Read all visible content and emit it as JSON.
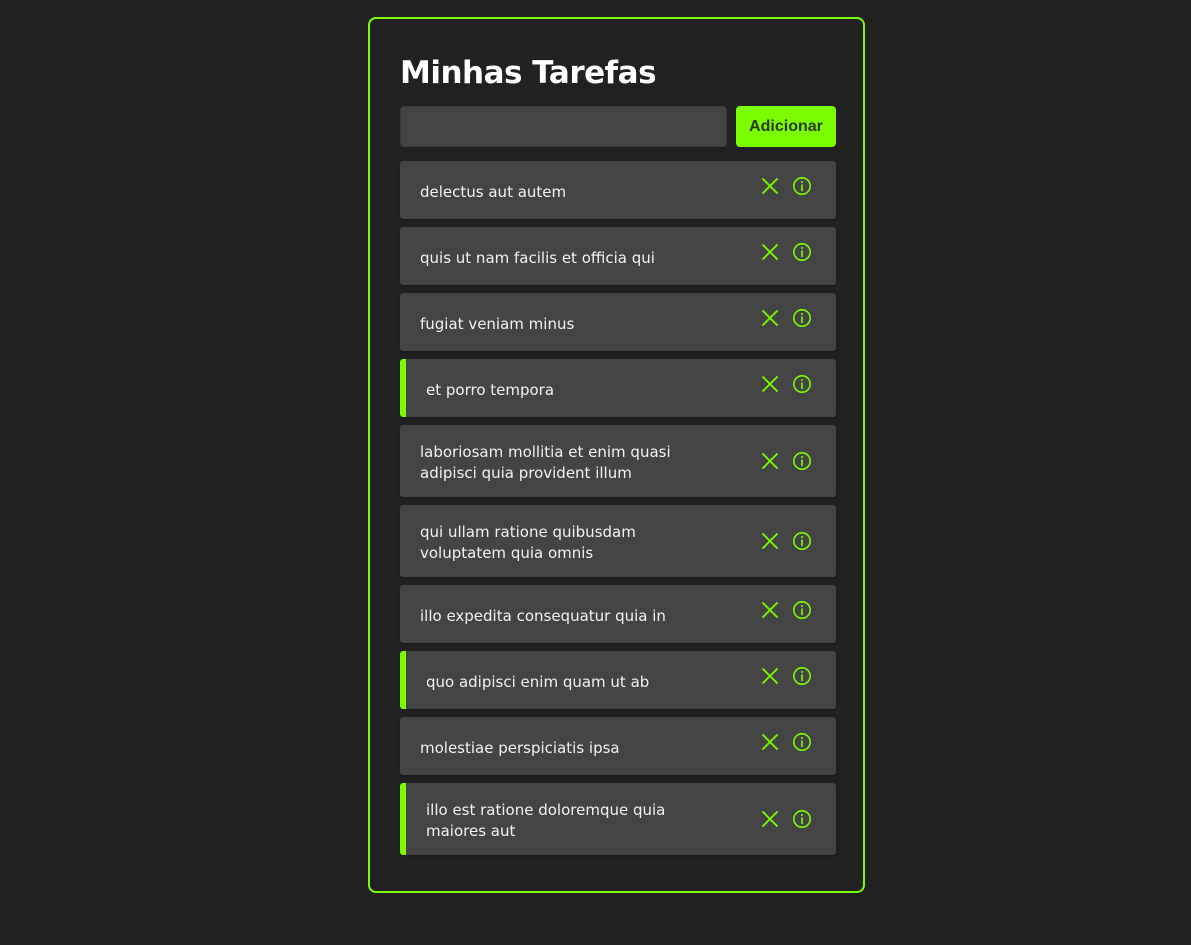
{
  "app": {
    "title": "Minhas Tarefas",
    "accent_color": "#7cfc00"
  },
  "new_task": {
    "value": "",
    "placeholder": "",
    "add_label": "Adicionar"
  },
  "tasks": [
    {
      "text": "delectus aut autem",
      "completed": false
    },
    {
      "text": "quis ut nam facilis et officia qui",
      "completed": false
    },
    {
      "text": "fugiat veniam minus",
      "completed": false
    },
    {
      "text": "et porro tempora",
      "completed": true
    },
    {
      "text": "laboriosam mollitia et enim quasi adipisci quia provident illum",
      "completed": false
    },
    {
      "text": "qui ullam ratione quibusdam voluptatem quia omnis",
      "completed": false
    },
    {
      "text": "illo expedita consequatur quia in",
      "completed": false
    },
    {
      "text": "quo adipisci enim quam ut ab",
      "completed": true
    },
    {
      "text": "molestiae perspiciatis ipsa",
      "completed": false
    },
    {
      "text": "illo est ratione doloremque quia maiores aut",
      "completed": true
    }
  ],
  "icons": {
    "delete": "close-icon",
    "details": "info-icon"
  }
}
